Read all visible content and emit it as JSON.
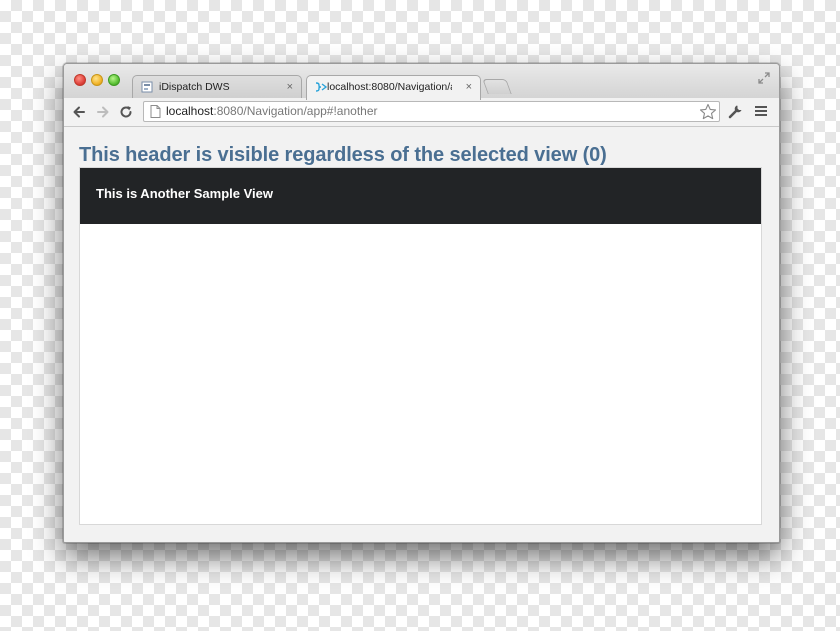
{
  "browser": {
    "tabs": [
      {
        "title": "iDispatch DWS",
        "active": false,
        "close_label": "×"
      },
      {
        "title": "localhost:8080/Navigation/a",
        "active": true,
        "close_label": "×"
      }
    ],
    "address": {
      "host": "localhost",
      "rest": ":8080/Navigation/app#!another"
    }
  },
  "page": {
    "heading": "This header is visible regardless of the selected view (0)",
    "view_title": "This is Another Sample View"
  },
  "colors": {
    "heading": "#4a6f92",
    "view_header_bg": "#222426"
  },
  "icons": [
    "back-icon",
    "forward-icon",
    "reload-icon",
    "page-icon",
    "star-icon",
    "wrench-icon",
    "menu-icon",
    "fullscreen-icon"
  ]
}
